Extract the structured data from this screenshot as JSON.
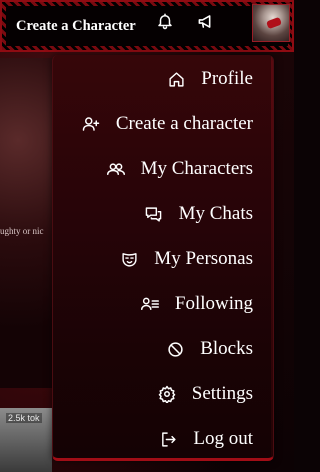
{
  "topbar": {
    "create_label": "Create a Character"
  },
  "background": {
    "card_snippet": "ughty or nic",
    "thumb_tag": "2.5k tok"
  },
  "menu": {
    "items": [
      {
        "label": "Profile",
        "icon": "home-icon"
      },
      {
        "label": "Create a character",
        "icon": "user-plus-icon"
      },
      {
        "label": "My Characters",
        "icon": "users-icon"
      },
      {
        "label": "My Chats",
        "icon": "chat-bubbles-icon"
      },
      {
        "label": "My Personas",
        "icon": "mask-icon"
      },
      {
        "label": "Following",
        "icon": "user-list-icon"
      },
      {
        "label": "Blocks",
        "icon": "block-icon"
      },
      {
        "label": "Settings",
        "icon": "gear-icon"
      },
      {
        "label": "Log out",
        "icon": "logout-icon"
      }
    ]
  },
  "colors": {
    "accent": "#a10d16",
    "menu_bg_top": "#360609",
    "menu_bg_bottom": "#140204"
  }
}
